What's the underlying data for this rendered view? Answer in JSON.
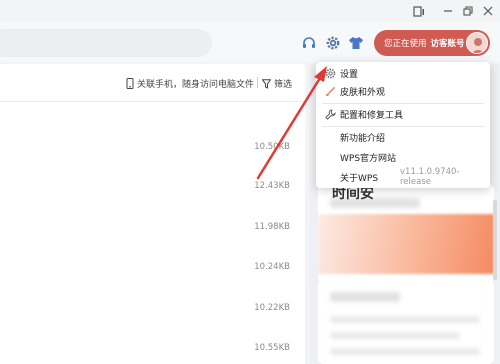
{
  "topbar": {
    "account": {
      "status_label": "您正在使用",
      "account_label": "访客账号"
    }
  },
  "toolbar": {
    "link_phone_label": "关联手机，随身访问电脑文件",
    "filter_label": "筛选"
  },
  "file_sizes": [
    "10.50KB",
    "12.43KB",
    "11.98KB",
    "10.24KB",
    "10.22KB",
    "10.55KB"
  ],
  "right_panel": {
    "card_title": "时间安"
  },
  "menu": {
    "items": [
      {
        "label": "设置",
        "icon": "gear-icon"
      },
      {
        "label": "皮肤和外观",
        "icon": "brush-icon"
      },
      {
        "label": "配置和修复工具",
        "icon": "wrench-icon"
      },
      {
        "label": "新功能介绍"
      },
      {
        "label": "WPS官方网站"
      },
      {
        "label": "关于WPS",
        "version": "v11.1.0.9740-release"
      }
    ]
  },
  "colors": {
    "accent": "#cf5b52",
    "arrow": "#e03a35"
  }
}
